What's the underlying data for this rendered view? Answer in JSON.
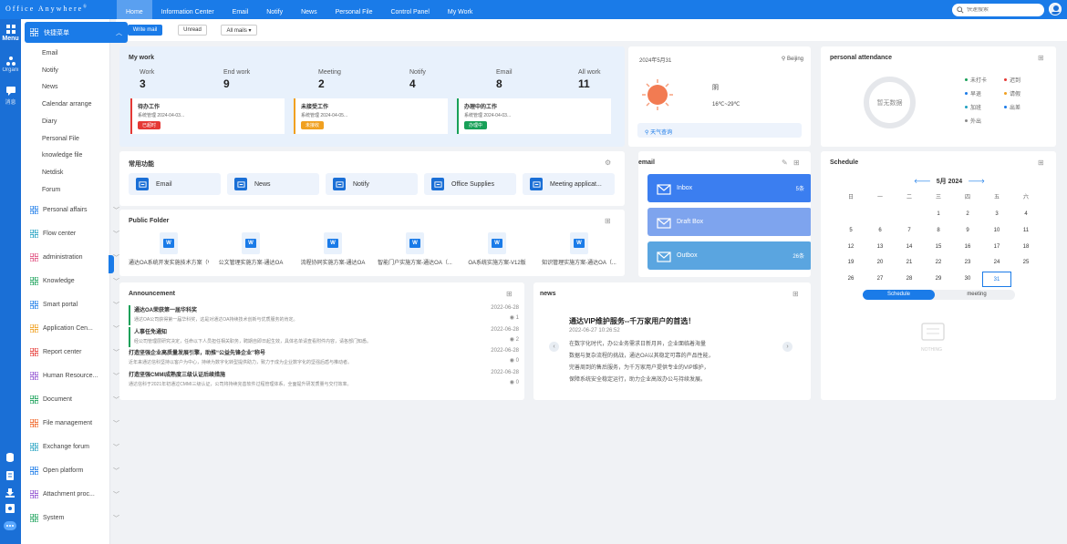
{
  "app": {
    "logo": "Office Anywhere",
    "logo_mark": "®"
  },
  "nav": {
    "tabs": [
      "Home",
      "Information Center",
      "Email",
      "Notify",
      "News",
      "Personal File",
      "Control Panel",
      "My Work"
    ],
    "active": "Home"
  },
  "search": {
    "placeholder": "快速搜索"
  },
  "iconbar": {
    "menu_label": "Menu",
    "org_label": "Organi",
    "im_label": "消息"
  },
  "menu": {
    "head": "快捷菜单",
    "subitems": [
      "Email",
      "Notify",
      "News",
      "Calendar arrange",
      "Diary",
      "Personal File",
      "knowledge file",
      "Netdisk",
      "Forum"
    ],
    "categories": [
      "Personal affairs",
      "Flow center",
      "administration",
      "Knowledge",
      "Smart portal",
      "Application Cen...",
      "Report center",
      "Human Resource...",
      "Document",
      "File management",
      "Exchange forum",
      "Open platform",
      "Attachment proc...",
      "System"
    ]
  },
  "toolbar": {
    "write": "Write mail",
    "unread": "Unread",
    "all": "All mails ▾"
  },
  "mywork": {
    "title": "My work",
    "stats": [
      {
        "label": "Work",
        "value": "3"
      },
      {
        "label": "End work",
        "value": "9"
      },
      {
        "label": "Meeting",
        "value": "2"
      },
      {
        "label": "Notify",
        "value": "4"
      },
      {
        "label": "Email",
        "value": "8"
      },
      {
        "label": "All work",
        "value": "11"
      }
    ],
    "items": [
      {
        "title": "待办工作",
        "date": "系统管理  2024-04-03...",
        "badge": "已超时",
        "color": "#e53935"
      },
      {
        "title": "未接受工作",
        "date": "系统管理  2024-04-05...",
        "badge": "未接收",
        "color": "#f0a020"
      },
      {
        "title": "办理中的工作",
        "date": "系统管理  2024-04-03...",
        "badge": "办理中",
        "color": "#18a058"
      }
    ]
  },
  "weather": {
    "date": "2024年5月31",
    "city": "Beijing",
    "cond": "阴",
    "temp": "16℃~29℃",
    "search": "天气查询"
  },
  "attendance": {
    "title": "personal attendance",
    "ring": "暂无数据",
    "legend": [
      "未打卡",
      "迟到",
      "早退",
      "请假",
      "加班",
      "出差",
      "外出"
    ]
  },
  "functions": {
    "title": "常用功能",
    "items": [
      "Email",
      "News",
      "Notify",
      "Office Supplies",
      "Meeting applicat..."
    ]
  },
  "email": {
    "title": "email",
    "items": [
      {
        "label": "Inbox",
        "count": "5条"
      },
      {
        "label": "Draft Box",
        "count": ""
      },
      {
        "label": "Outbox",
        "count": "26条"
      }
    ]
  },
  "schedule": {
    "title": "Schedule",
    "month": "5月  2024",
    "weekdays": [
      "日",
      "一",
      "二",
      "三",
      "四",
      "五",
      "六"
    ],
    "days": [
      "",
      "",
      "",
      "1",
      "2",
      "3",
      "4",
      "5",
      "6",
      "7",
      "8",
      "9",
      "10",
      "11",
      "12",
      "13",
      "14",
      "15",
      "16",
      "17",
      "18",
      "19",
      "20",
      "21",
      "22",
      "23",
      "24",
      "25",
      "26",
      "27",
      "28",
      "29",
      "30",
      "31",
      ""
    ],
    "today": "31",
    "tab_on": "Schedule",
    "tab_off": "meeting",
    "empty": "NOTHING"
  },
  "folder": {
    "title": "Public Folder",
    "files": [
      "通达OA系统开发实施技术方案（V...",
      "公文管理实施方案-通达OA",
      "流程协同实施方案-通达OA",
      "智能门户实施方案-通达OA（...",
      "OA系统实施方案-V12版",
      "知识管理实施方案-通达OA（..."
    ]
  },
  "announcement": {
    "title": "Announcement",
    "items": [
      {
        "title": "通达OA荣获第一届华科奖",
        "desc": "通达OA公司获得第一届华科奖，这是对通达OA持续技术创新与优质服务的肯定。",
        "date": "2022-06-28",
        "count": "1"
      },
      {
        "title": "人事任免通知",
        "desc": "经公司管理层研究决定，任命以下人员担任相关职务，聘期自即日起生效，具体名单请查看附件内容，请各部门知悉。",
        "date": "2022-06-28",
        "count": "2"
      },
      {
        "title": "打造坚强企业高质量发展引擎，助推“公益先锋企业”称号",
        "desc": "近年来通达信科坚持以客户为中心，持续为数字化转型提供助力，致力于成为企业数字化的坚强后盾与推动者。",
        "date": "2022-06-28",
        "count": "0"
      },
      {
        "title": "打造坚强CMMI成熟度三级认证后续措施",
        "desc": "通达信科于2021年初通过CMMI三级认证，公司将持续完善软件过程管理体系，全面提升研发质量与交付效率。",
        "date": "2022-06-28",
        "count": "0"
      }
    ]
  },
  "news": {
    "title": "news",
    "headline": "通达VIP维护服务--千万家用户的首选！",
    "date": "2022-06-27  10:26:52",
    "lines": [
      "在数字化时代，办公业务需求日新月异，企业面临着海量",
      "数据与复杂流程的挑战，通达OA以其稳定可靠的产品性能，",
      "完善周到的售后服务，为千万家用户提供专业的VIP维护，",
      "保障系统安全稳定运行，助力企业高效办公与持续发展。"
    ]
  }
}
